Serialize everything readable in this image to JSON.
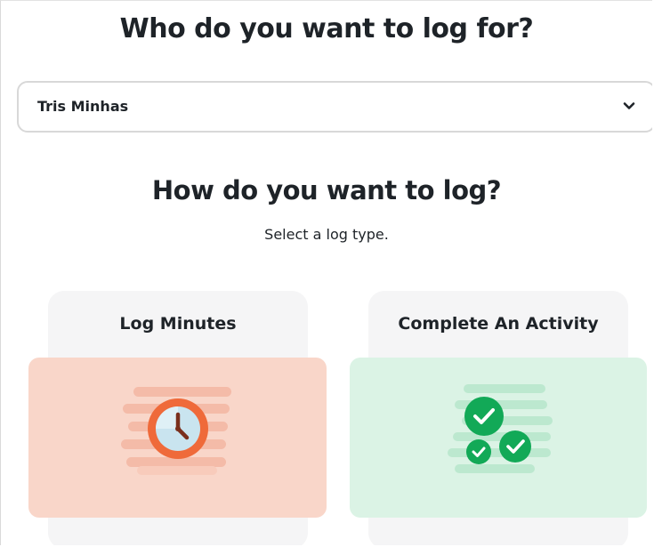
{
  "header": {
    "who_title": "Who do you want to log for?"
  },
  "reader_select": {
    "selected": "Tris Minhas"
  },
  "log_section": {
    "title": "How do you want to log?",
    "hint": "Select a log type."
  },
  "options": [
    {
      "label": "Log Minutes",
      "icon": "clock-icon",
      "color": "#f9d6c9"
    },
    {
      "label": "Complete An Activity",
      "icon": "checkmarks-icon",
      "color": "#dbf3e5"
    }
  ],
  "colors": {
    "text": "#1e2328",
    "clock_orange": "#ef6a3a",
    "check_green": "#12a957"
  }
}
